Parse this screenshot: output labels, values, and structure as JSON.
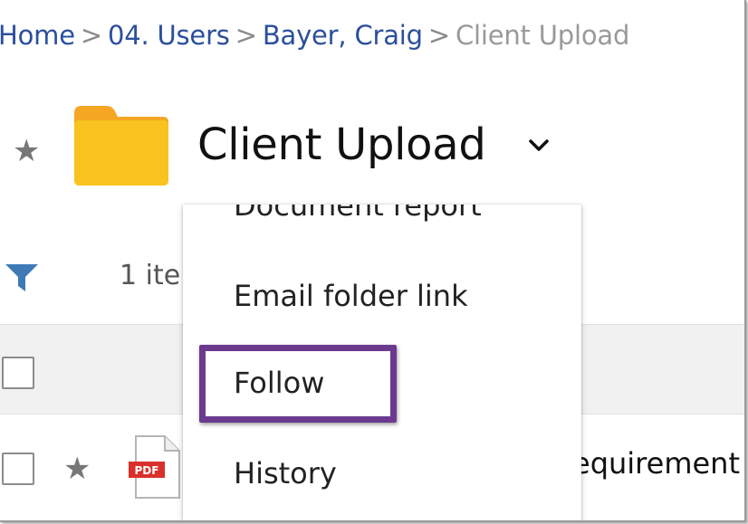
{
  "breadcrumb": {
    "home": "Home",
    "users": "04. Users",
    "user": "Bayer, Craig",
    "current": "Client Upload",
    "separator": ">"
  },
  "folder": {
    "title": "Client Upload",
    "folder_icon": "folder-icon",
    "color": "#F9C31F"
  },
  "toolbar": {
    "item_count": "1 ite"
  },
  "dropdown_menu": {
    "items": [
      {
        "label": "Document report"
      },
      {
        "label": "Email folder link"
      },
      {
        "label": "Follow"
      },
      {
        "label": "History"
      }
    ],
    "highlight_color": "#6B3A8F"
  },
  "file_list": {
    "rows": [
      {
        "name": "equirement",
        "type_label": "PDF"
      }
    ]
  },
  "colors": {
    "link": "#2B4F9C",
    "filter_icon": "#3E7BB6",
    "pdf_badge": "#D9302B"
  }
}
